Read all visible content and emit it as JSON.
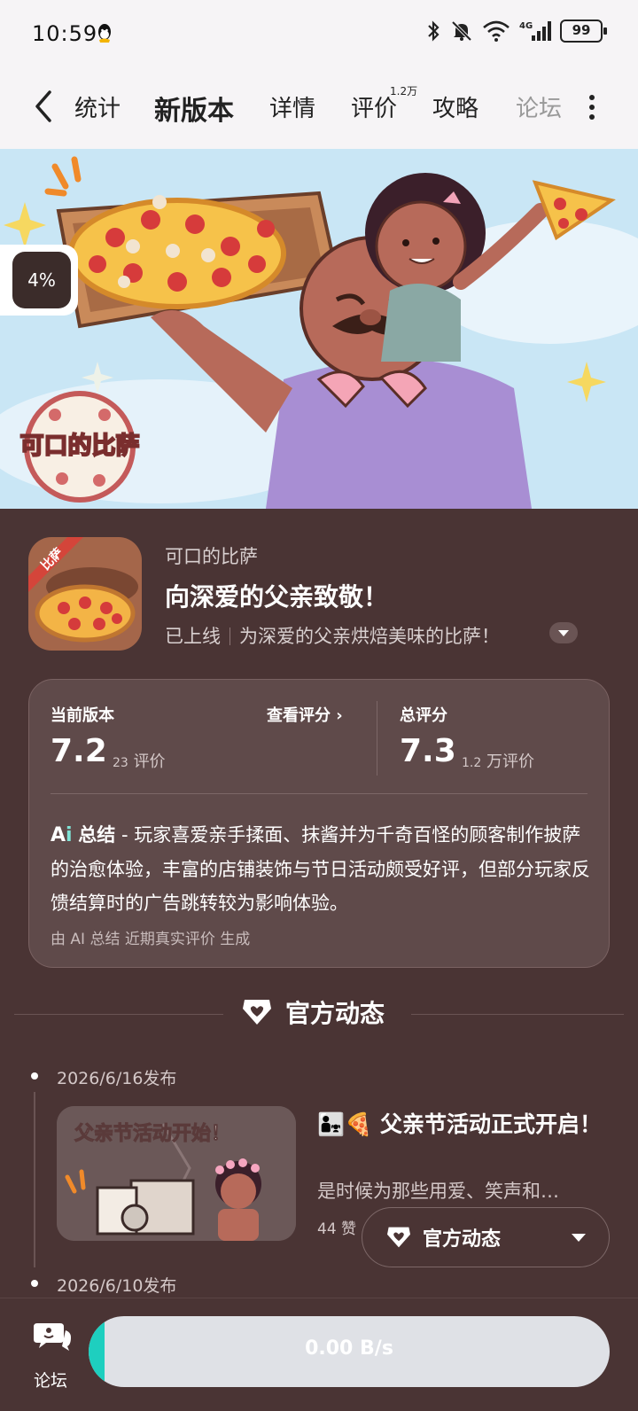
{
  "status_bar": {
    "time": "10:59",
    "battery": "99",
    "network": "4G"
  },
  "tabs": [
    {
      "label": "统计"
    },
    {
      "label": "新版本",
      "active": true
    },
    {
      "label": "详情"
    },
    {
      "label": "评价",
      "badge": "1.2万"
    },
    {
      "label": "攻略"
    },
    {
      "label": "论坛"
    }
  ],
  "banner": {
    "logo_text": "可口的比萨",
    "progress_badge": "4%"
  },
  "app": {
    "name": "可口的比萨",
    "headline": "向深爱的父亲致敬！",
    "status": "已上线",
    "tagline": "为深爱的父亲烘焙美味的比萨！",
    "icon_ribbon": "比萨"
  },
  "rating": {
    "current_label": "当前版本",
    "view_link": "查看评分",
    "current_score": "7.2",
    "current_count": "23",
    "current_count_suffix": "评价",
    "total_label": "总评分",
    "total_score": "7.3",
    "total_count": "1.2",
    "total_count_suffix": "万评价",
    "ai_title": "总结",
    "ai_text": " - 玩家喜爱亲手揉面、抹酱并为千奇百怪的顾客制作披萨的治愈体验，丰富的店铺装饰与节日活动颇受好评，但部分玩家反馈结算时的广告跳转较为影响体验。",
    "ai_footer": "由 AI 总结 近期真实评价 生成"
  },
  "section": {
    "title": "官方动态"
  },
  "posts": [
    {
      "date": "2026/6/16发布",
      "thumb_text": "父亲节活动开始！",
      "title": "父亲节活动正式开启！",
      "desc": "是时候为那些用爱、笑声和…",
      "likes": "44 赞"
    },
    {
      "date": "2026/6/10发布"
    }
  ],
  "floating": {
    "label": "官方动态"
  },
  "bottom": {
    "forum_label": "论坛",
    "download_text": "0.00 B/s",
    "progress": 0.03
  },
  "colors": {
    "accent": "#1ed2c0",
    "background": "#4a3434",
    "card": "#5f4a4a"
  }
}
